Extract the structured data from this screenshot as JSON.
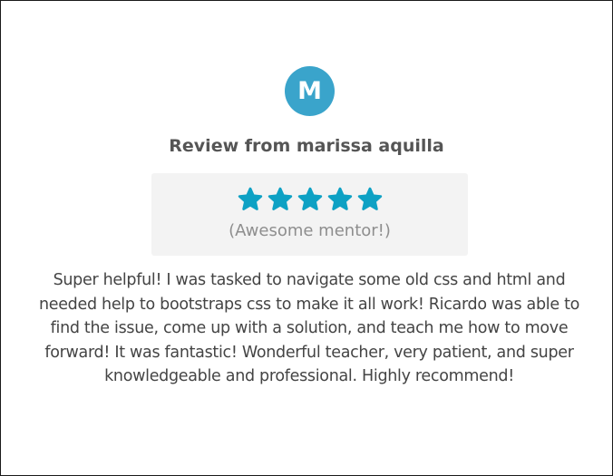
{
  "reviewer": {
    "avatar_initial": "M",
    "title": "Review from marissa aquilla"
  },
  "rating": {
    "stars": 5,
    "max_stars": 5,
    "label": "(Awesome mentor!)",
    "star_color": "#0ea1c4"
  },
  "colors": {
    "avatar_bg": "#3aa4cb",
    "rating_box_bg": "#f3f3f3"
  },
  "review": {
    "text": "Super helpful! I was tasked to navigate some old css and html and needed help to bootstraps css to make it all work! Ricardo was able to find the issue, come up with a solution, and teach me how to move forward! It was fantastic! Wonderful teacher, very patient, and super knowledgeable and professional. Highly recommend!"
  }
}
